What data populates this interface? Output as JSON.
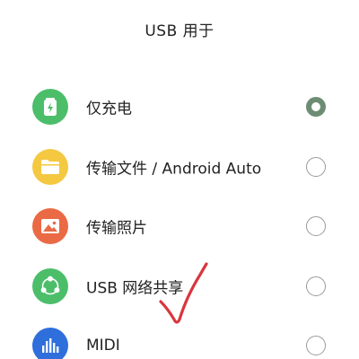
{
  "header": {
    "title": "USB 用于"
  },
  "options": [
    {
      "label": "仅充电",
      "icon": "battery-charging-icon",
      "color": "#4cbe6a",
      "selected": true
    },
    {
      "label": "传输文件 / Android Auto",
      "icon": "folder-icon",
      "color": "#f5c842",
      "selected": false
    },
    {
      "label": "传输照片",
      "icon": "photo-icon",
      "color": "#ea6a45",
      "selected": false
    },
    {
      "label": "USB 网络共享",
      "icon": "share-network-icon",
      "color": "#4cbe6a",
      "selected": false
    },
    {
      "label": "MIDI",
      "icon": "midi-equalizer-icon",
      "color": "#2f6fdc",
      "selected": false
    }
  ],
  "colors": {
    "radio_checked": "#6d8c74",
    "annotation": "#d9363e"
  }
}
